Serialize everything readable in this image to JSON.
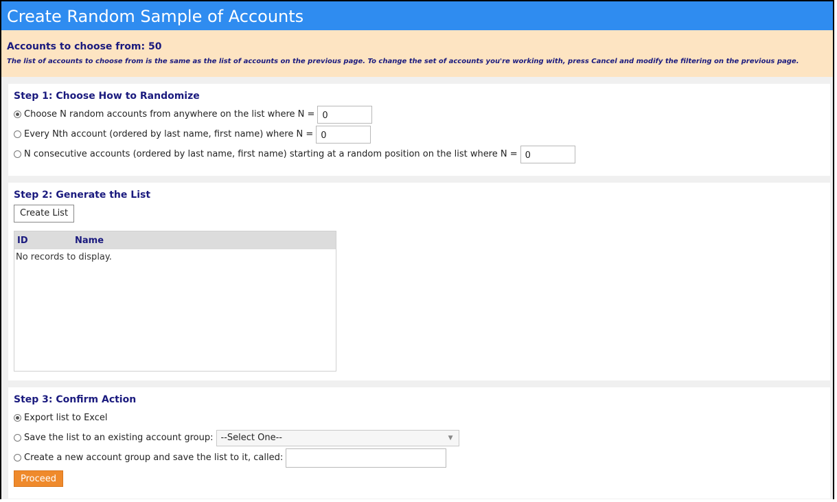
{
  "title": "Create Random Sample of Accounts",
  "banner": {
    "count_text": "Accounts to choose from: 50",
    "note": "The list of accounts to choose from is the same as the list of accounts on the previous page. To change the set of accounts you're working with, press Cancel and modify the filtering on the previous page."
  },
  "step1": {
    "heading": "Step 1: Choose How to Randomize",
    "options": [
      {
        "label": "Choose N random accounts from anywhere on the list where N =",
        "value": "0",
        "checked": true
      },
      {
        "label": "Every Nth account (ordered by last name, first name) where N =",
        "value": "0",
        "checked": false
      },
      {
        "label": "N consecutive accounts (ordered by last name, first name) starting at a random position on the list where N =",
        "value": "0",
        "checked": false
      }
    ]
  },
  "step2": {
    "heading": "Step 2: Generate the List",
    "create_button": "Create List",
    "grid": {
      "columns": [
        "ID",
        "Name"
      ],
      "empty_text": "No records to display."
    }
  },
  "step3": {
    "heading": "Step 3: Confirm Action",
    "options": [
      {
        "label": "Export list to Excel",
        "checked": true
      },
      {
        "label": "Save the list to an existing account group:",
        "checked": false
      },
      {
        "label": "Create a new account group and save the list to it, called:",
        "checked": false
      }
    ],
    "select_value": "--Select One--",
    "new_group_value": "",
    "proceed_button": "Proceed"
  },
  "colors": {
    "titlebar": "#2f8cf0",
    "banner_bg": "#fde4c2",
    "heading": "#1a1a7e",
    "proceed": "#ef8a2c"
  }
}
